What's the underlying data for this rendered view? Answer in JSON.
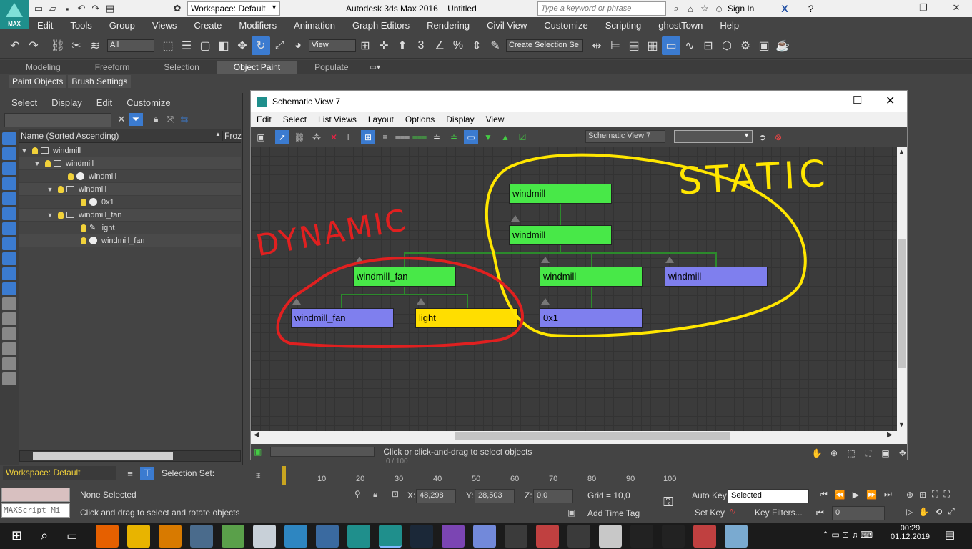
{
  "window": {
    "title": "Autodesk 3ds Max 2016",
    "doc": "Untitled",
    "workspace": "Workspace: Default",
    "search_placeholder": "Type a keyword or phrase",
    "sign_in": "Sign In",
    "logo": "MAX"
  },
  "menu": [
    "Edit",
    "Tools",
    "Group",
    "Views",
    "Create",
    "Modifiers",
    "Animation",
    "Graph Editors",
    "Rendering",
    "Civil View",
    "Customize",
    "Scripting",
    "ghostTown",
    "Help"
  ],
  "toolbar": {
    "filter": "All",
    "refcoord": "View",
    "selset": "Create Selection Se",
    "angle": "3",
    "pct": "%"
  },
  "ribbon": {
    "tabs": [
      "Modeling",
      "Freeform",
      "Selection",
      "Object Paint",
      "Populate"
    ],
    "active": "Object Paint",
    "subtabs": [
      "Paint Objects",
      "Brush Settings"
    ]
  },
  "explorer": {
    "menu": [
      "Select",
      "Display",
      "Edit",
      "Customize"
    ],
    "col_name": "Name (Sorted Ascending)",
    "col_froz": "Froz",
    "rows": [
      {
        "label": "windmill",
        "depth": 0
      },
      {
        "label": "windmill",
        "depth": 1
      },
      {
        "label": "windmill",
        "depth": 2
      },
      {
        "label": "windmill",
        "depth": 2
      },
      {
        "label": "0x1",
        "depth": 3
      },
      {
        "label": "windmill_fan",
        "depth": 2
      },
      {
        "label": "light",
        "depth": 3
      },
      {
        "label": "windmill_fan",
        "depth": 3
      }
    ]
  },
  "schematic": {
    "title": "Schematic View 7",
    "menu": [
      "Edit",
      "Select",
      "List Views",
      "Layout",
      "Options",
      "Display",
      "View"
    ],
    "view_name": "Schematic View 7",
    "status": "Click or click-and-drag to select objects",
    "nodes": {
      "n1": "windmill",
      "n2": "windmill",
      "n3": "windmill_fan",
      "n4": "windmill",
      "n5": "windmill",
      "n6": "windmill_fan",
      "n7": "light",
      "n8": "0x1"
    },
    "annotations": {
      "static": "STATIC",
      "dynamic": "DYNAMIC"
    }
  },
  "timeline": {
    "ticks": [
      "10",
      "20",
      "30",
      "40",
      "50",
      "60",
      "70",
      "80",
      "90",
      "100"
    ],
    "frame": "0 / 100"
  },
  "status": {
    "maxscript": "MAXScript Mi",
    "selection": "None Selected",
    "hint": "Click and drag to select and rotate objects",
    "x_label": "X:",
    "x": "48,298",
    "y_label": "Y:",
    "y": "28,503",
    "z_label": "Z:",
    "z": "0,0",
    "grid": "Grid = 10,0",
    "add_time_tag": "Add Time Tag",
    "auto_key": "Auto Key",
    "selected": "Selected",
    "set_key": "Set Key",
    "key_filters": "Key Filters...",
    "frame_field": "0",
    "ws": "Workspace: Default",
    "selection_set": "Selection Set:"
  },
  "taskbar": {
    "time": "00:29",
    "date": "01.12.2019"
  },
  "colors": {
    "node_green": "#48e848",
    "node_blue": "#7f7fee",
    "node_yellow": "#ffde00",
    "static_yellow": "#ffe600",
    "dynamic_red": "#e02020"
  }
}
